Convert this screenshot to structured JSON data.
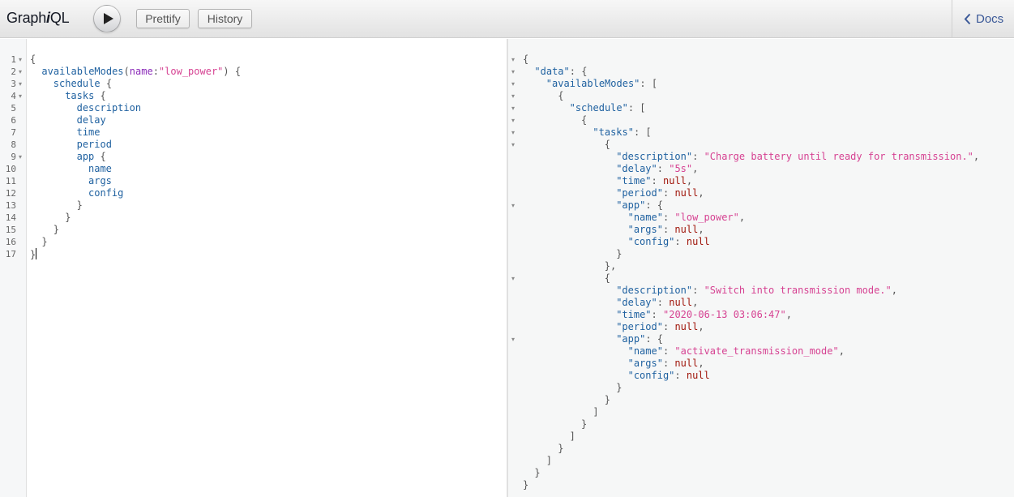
{
  "app": {
    "title_prefix": "Graph",
    "title_em": "i",
    "title_suffix": "QL"
  },
  "toolbar": {
    "run_icon": "play-icon",
    "prettify_label": "Prettify",
    "history_label": "History"
  },
  "docs": {
    "icon": "chevron-left-icon",
    "label": "Docs"
  },
  "colors": {
    "field": "#1f61a0",
    "string": "#d64292",
    "null": "#a0160b",
    "attr": "#8b2bb9",
    "link": "#3b5998"
  },
  "query": {
    "lines": [
      {
        "num": "1",
        "fold": true,
        "indent": 0,
        "tokens": [
          {
            "t": "punct",
            "v": "{"
          }
        ]
      },
      {
        "num": "2",
        "fold": true,
        "indent": 1,
        "tokens": [
          {
            "t": "field",
            "v": "availableModes"
          },
          {
            "t": "punct",
            "v": "("
          },
          {
            "t": "attr",
            "v": "name"
          },
          {
            "t": "punct",
            "v": ":"
          },
          {
            "t": "string",
            "v": "\"low_power\""
          },
          {
            "t": "punct",
            "v": ") {"
          }
        ]
      },
      {
        "num": "3",
        "fold": true,
        "indent": 2,
        "tokens": [
          {
            "t": "field",
            "v": "schedule"
          },
          {
            "t": "punct",
            "v": " {"
          }
        ]
      },
      {
        "num": "4",
        "fold": true,
        "indent": 3,
        "tokens": [
          {
            "t": "field",
            "v": "tasks"
          },
          {
            "t": "punct",
            "v": " {"
          }
        ]
      },
      {
        "num": "5",
        "fold": false,
        "indent": 4,
        "tokens": [
          {
            "t": "field",
            "v": "description"
          }
        ]
      },
      {
        "num": "6",
        "fold": false,
        "indent": 4,
        "tokens": [
          {
            "t": "field",
            "v": "delay"
          }
        ]
      },
      {
        "num": "7",
        "fold": false,
        "indent": 4,
        "tokens": [
          {
            "t": "field",
            "v": "time"
          }
        ]
      },
      {
        "num": "8",
        "fold": false,
        "indent": 4,
        "tokens": [
          {
            "t": "field",
            "v": "period"
          }
        ]
      },
      {
        "num": "9",
        "fold": true,
        "indent": 4,
        "tokens": [
          {
            "t": "field",
            "v": "app"
          },
          {
            "t": "punct",
            "v": " {"
          }
        ]
      },
      {
        "num": "10",
        "fold": false,
        "indent": 5,
        "tokens": [
          {
            "t": "field",
            "v": "name"
          }
        ]
      },
      {
        "num": "11",
        "fold": false,
        "indent": 5,
        "tokens": [
          {
            "t": "field",
            "v": "args"
          }
        ]
      },
      {
        "num": "12",
        "fold": false,
        "indent": 5,
        "tokens": [
          {
            "t": "field",
            "v": "config"
          }
        ]
      },
      {
        "num": "13",
        "fold": false,
        "indent": 4,
        "tokens": [
          {
            "t": "punct",
            "v": "}"
          }
        ]
      },
      {
        "num": "14",
        "fold": false,
        "indent": 3,
        "tokens": [
          {
            "t": "punct",
            "v": "}"
          }
        ]
      },
      {
        "num": "15",
        "fold": false,
        "indent": 2,
        "tokens": [
          {
            "t": "punct",
            "v": "}"
          }
        ]
      },
      {
        "num": "16",
        "fold": false,
        "indent": 1,
        "tokens": [
          {
            "t": "punct",
            "v": "}"
          }
        ]
      },
      {
        "num": "17",
        "fold": false,
        "indent": 0,
        "tokens": [
          {
            "t": "punct",
            "v": "}"
          }
        ],
        "cursor": true
      }
    ]
  },
  "result": {
    "lines": [
      {
        "fold": true,
        "indent": 0,
        "tokens": [
          {
            "t": "punct",
            "v": "{"
          }
        ]
      },
      {
        "fold": true,
        "indent": 1,
        "tokens": [
          {
            "t": "key",
            "v": "\"data\""
          },
          {
            "t": "punct",
            "v": ": {"
          }
        ]
      },
      {
        "fold": true,
        "indent": 2,
        "tokens": [
          {
            "t": "key",
            "v": "\"availableModes\""
          },
          {
            "t": "punct",
            "v": ": ["
          }
        ]
      },
      {
        "fold": true,
        "indent": 3,
        "tokens": [
          {
            "t": "punct",
            "v": "{"
          }
        ]
      },
      {
        "fold": true,
        "indent": 4,
        "tokens": [
          {
            "t": "key",
            "v": "\"schedule\""
          },
          {
            "t": "punct",
            "v": ": ["
          }
        ]
      },
      {
        "fold": true,
        "indent": 5,
        "tokens": [
          {
            "t": "punct",
            "v": "{"
          }
        ]
      },
      {
        "fold": true,
        "indent": 6,
        "tokens": [
          {
            "t": "key",
            "v": "\"tasks\""
          },
          {
            "t": "punct",
            "v": ": ["
          }
        ]
      },
      {
        "fold": true,
        "indent": 7,
        "tokens": [
          {
            "t": "punct",
            "v": "{"
          }
        ]
      },
      {
        "fold": false,
        "indent": 8,
        "tokens": [
          {
            "t": "key",
            "v": "\"description\""
          },
          {
            "t": "punct",
            "v": ": "
          },
          {
            "t": "string",
            "v": "\"Charge battery until ready for transmission.\""
          },
          {
            "t": "punct",
            "v": ","
          }
        ]
      },
      {
        "fold": false,
        "indent": 8,
        "tokens": [
          {
            "t": "key",
            "v": "\"delay\""
          },
          {
            "t": "punct",
            "v": ": "
          },
          {
            "t": "string",
            "v": "\"5s\""
          },
          {
            "t": "punct",
            "v": ","
          }
        ]
      },
      {
        "fold": false,
        "indent": 8,
        "tokens": [
          {
            "t": "key",
            "v": "\"time\""
          },
          {
            "t": "punct",
            "v": ": "
          },
          {
            "t": "null",
            "v": "null"
          },
          {
            "t": "punct",
            "v": ","
          }
        ]
      },
      {
        "fold": false,
        "indent": 8,
        "tokens": [
          {
            "t": "key",
            "v": "\"period\""
          },
          {
            "t": "punct",
            "v": ": "
          },
          {
            "t": "null",
            "v": "null"
          },
          {
            "t": "punct",
            "v": ","
          }
        ]
      },
      {
        "fold": true,
        "indent": 8,
        "tokens": [
          {
            "t": "key",
            "v": "\"app\""
          },
          {
            "t": "punct",
            "v": ": {"
          }
        ]
      },
      {
        "fold": false,
        "indent": 9,
        "tokens": [
          {
            "t": "key",
            "v": "\"name\""
          },
          {
            "t": "punct",
            "v": ": "
          },
          {
            "t": "string",
            "v": "\"low_power\""
          },
          {
            "t": "punct",
            "v": ","
          }
        ]
      },
      {
        "fold": false,
        "indent": 9,
        "tokens": [
          {
            "t": "key",
            "v": "\"args\""
          },
          {
            "t": "punct",
            "v": ": "
          },
          {
            "t": "null",
            "v": "null"
          },
          {
            "t": "punct",
            "v": ","
          }
        ]
      },
      {
        "fold": false,
        "indent": 9,
        "tokens": [
          {
            "t": "key",
            "v": "\"config\""
          },
          {
            "t": "punct",
            "v": ": "
          },
          {
            "t": "null",
            "v": "null"
          }
        ]
      },
      {
        "fold": false,
        "indent": 8,
        "tokens": [
          {
            "t": "punct",
            "v": "}"
          }
        ]
      },
      {
        "fold": false,
        "indent": 7,
        "tokens": [
          {
            "t": "punct",
            "v": "},"
          }
        ]
      },
      {
        "fold": true,
        "indent": 7,
        "tokens": [
          {
            "t": "punct",
            "v": "{"
          }
        ]
      },
      {
        "fold": false,
        "indent": 8,
        "tokens": [
          {
            "t": "key",
            "v": "\"description\""
          },
          {
            "t": "punct",
            "v": ": "
          },
          {
            "t": "string",
            "v": "\"Switch into transmission mode.\""
          },
          {
            "t": "punct",
            "v": ","
          }
        ]
      },
      {
        "fold": false,
        "indent": 8,
        "tokens": [
          {
            "t": "key",
            "v": "\"delay\""
          },
          {
            "t": "punct",
            "v": ": "
          },
          {
            "t": "null",
            "v": "null"
          },
          {
            "t": "punct",
            "v": ","
          }
        ]
      },
      {
        "fold": false,
        "indent": 8,
        "tokens": [
          {
            "t": "key",
            "v": "\"time\""
          },
          {
            "t": "punct",
            "v": ": "
          },
          {
            "t": "string",
            "v": "\"2020-06-13 03:06:47\""
          },
          {
            "t": "punct",
            "v": ","
          }
        ]
      },
      {
        "fold": false,
        "indent": 8,
        "tokens": [
          {
            "t": "key",
            "v": "\"period\""
          },
          {
            "t": "punct",
            "v": ": "
          },
          {
            "t": "null",
            "v": "null"
          },
          {
            "t": "punct",
            "v": ","
          }
        ]
      },
      {
        "fold": true,
        "indent": 8,
        "tokens": [
          {
            "t": "key",
            "v": "\"app\""
          },
          {
            "t": "punct",
            "v": ": {"
          }
        ]
      },
      {
        "fold": false,
        "indent": 9,
        "tokens": [
          {
            "t": "key",
            "v": "\"name\""
          },
          {
            "t": "punct",
            "v": ": "
          },
          {
            "t": "string",
            "v": "\"activate_transmission_mode\""
          },
          {
            "t": "punct",
            "v": ","
          }
        ]
      },
      {
        "fold": false,
        "indent": 9,
        "tokens": [
          {
            "t": "key",
            "v": "\"args\""
          },
          {
            "t": "punct",
            "v": ": "
          },
          {
            "t": "null",
            "v": "null"
          },
          {
            "t": "punct",
            "v": ","
          }
        ]
      },
      {
        "fold": false,
        "indent": 9,
        "tokens": [
          {
            "t": "key",
            "v": "\"config\""
          },
          {
            "t": "punct",
            "v": ": "
          },
          {
            "t": "null",
            "v": "null"
          }
        ]
      },
      {
        "fold": false,
        "indent": 8,
        "tokens": [
          {
            "t": "punct",
            "v": "}"
          }
        ]
      },
      {
        "fold": false,
        "indent": 7,
        "tokens": [
          {
            "t": "punct",
            "v": "}"
          }
        ]
      },
      {
        "fold": false,
        "indent": 6,
        "tokens": [
          {
            "t": "punct",
            "v": "]"
          }
        ]
      },
      {
        "fold": false,
        "indent": 5,
        "tokens": [
          {
            "t": "punct",
            "v": "}"
          }
        ]
      },
      {
        "fold": false,
        "indent": 4,
        "tokens": [
          {
            "t": "punct",
            "v": "]"
          }
        ]
      },
      {
        "fold": false,
        "indent": 3,
        "tokens": [
          {
            "t": "punct",
            "v": "}"
          }
        ]
      },
      {
        "fold": false,
        "indent": 2,
        "tokens": [
          {
            "t": "punct",
            "v": "]"
          }
        ]
      },
      {
        "fold": false,
        "indent": 1,
        "tokens": [
          {
            "t": "punct",
            "v": "}"
          }
        ]
      },
      {
        "fold": false,
        "indent": 0,
        "tokens": [
          {
            "t": "punct",
            "v": "}"
          }
        ]
      }
    ]
  }
}
